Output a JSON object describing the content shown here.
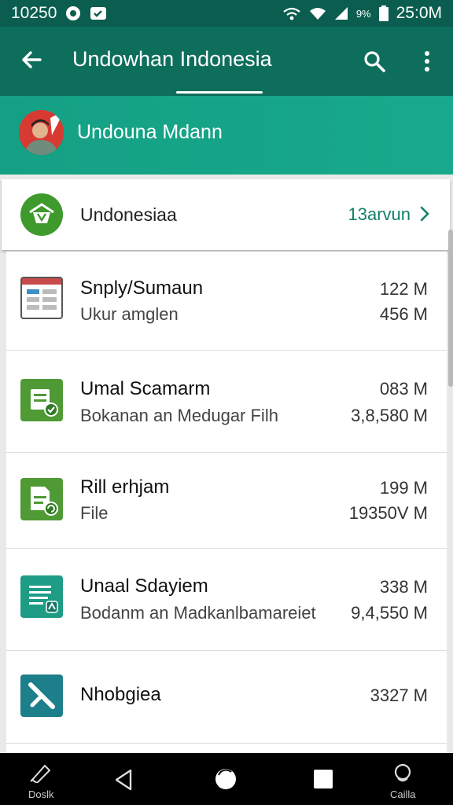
{
  "status_bar": {
    "left_text": "10250",
    "battery": "9%",
    "time": "25:0M",
    "icons": [
      "whatsapp-icon",
      "notification-icon",
      "wifi-calling-icon",
      "wifi-icon",
      "signal-icon",
      "battery-icon"
    ]
  },
  "app_bar": {
    "title": "Undowhan Indonesia",
    "icons": [
      "back-arrow-icon",
      "search-icon",
      "more-vert-icon"
    ]
  },
  "profile": {
    "name": "Undouna Mdann"
  },
  "summary": {
    "label": "Undonesiaa",
    "value": "13arvun"
  },
  "items": [
    {
      "title": "Snply/Sumaun",
      "subtitle": "Ukur amglen",
      "size_1": "122 M",
      "size_2": "456 M",
      "icon": "spreadsheet-icon"
    },
    {
      "title": "Umal Scamarm",
      "subtitle": "Bokanan an Medugar Filh",
      "size_1": "083 M",
      "size_2": "3,8,580 M",
      "icon": "document-check-icon"
    },
    {
      "title": "Rill erhjam",
      "subtitle": "File",
      "size_1": "199 M",
      "size_2": "19350V M",
      "icon": "file-sync-icon"
    },
    {
      "title": "Unaal Sdayiem",
      "subtitle": "Bodanm an Madkanlbamareiet",
      "size_1": "338 M",
      "size_2": "9,4,550 M",
      "icon": "notes-badge-icon"
    },
    {
      "title": "Nhobgiea",
      "subtitle": "",
      "size_1": "3327 M",
      "size_2": "",
      "icon": "arrow-tile-icon"
    }
  ],
  "nav_bar": {
    "left_caption": "Doslk",
    "right_caption": "Cailla"
  },
  "colors": {
    "status_bar": "#0b5e4f",
    "app_bar": "#0e6e5c",
    "profile_bar": "#16a387",
    "accent_text": "#12806b"
  }
}
